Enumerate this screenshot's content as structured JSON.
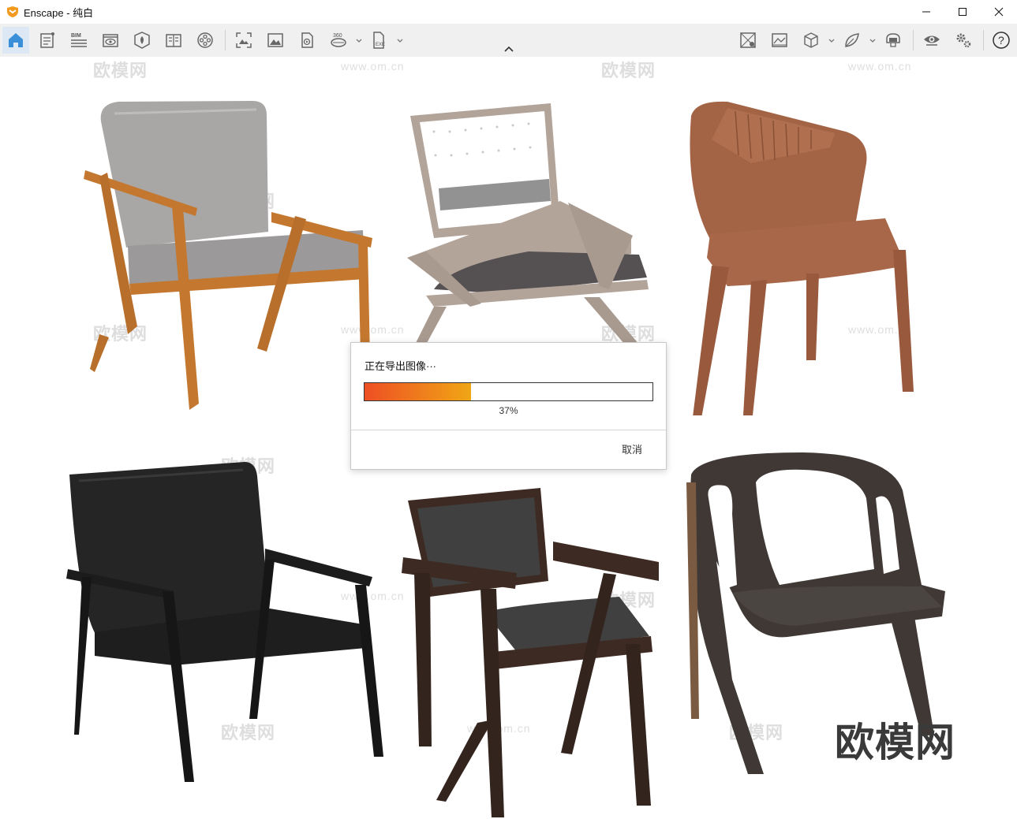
{
  "window": {
    "title": "Enscape - 纯白",
    "accent": "#f29a1f"
  },
  "toolbar": {
    "left_icons": [
      "home-icon",
      "document-icon",
      "bim-icon",
      "visibility-icon",
      "asset-library-icon",
      "book-icon",
      "film-reel-icon"
    ],
    "capture_icons": [
      "screenshot-icon",
      "image-icon",
      "video-icon",
      "panorama-360-icon",
      "exe-export-icon"
    ],
    "right_icons": [
      "material-icon",
      "texture-icon",
      "cube-icon",
      "leaf-icon",
      "vr-headset-icon",
      "eye-icon",
      "settings-icon",
      "help-icon"
    ],
    "bim_label": "BIM",
    "pano_label": "360",
    "exe_label": "EXE",
    "help_label": "?"
  },
  "viewport": {
    "background": "#ffffff",
    "watermark_text": "欧模网",
    "watermark_url": "www.om.cn",
    "brand_text": "欧模网",
    "chairs": [
      {
        "name": "wooden-lounge-chair",
        "frame": "#c4782f",
        "cushion": "#9c999a"
      },
      {
        "name": "rattan-back-chair",
        "frame": "#b3a49a",
        "cushion": "#555153"
      },
      {
        "name": "leather-dining-chair",
        "frame": "#a36345",
        "cushion": "#a36345"
      },
      {
        "name": "black-lounge-chair",
        "frame": "#1c1c1c",
        "cushion": "#262525"
      },
      {
        "name": "dark-wood-leather-chair",
        "frame": "#3d2a22",
        "cushion": "#404040"
      },
      {
        "name": "sculpted-shell-chair",
        "frame": "#3f3835",
        "cushion": "#4a4541"
      }
    ]
  },
  "dialog": {
    "title": "正在导出图像···",
    "progress_fraction": 0.37,
    "progress_percent": "37%",
    "cancel_label": "取消"
  }
}
